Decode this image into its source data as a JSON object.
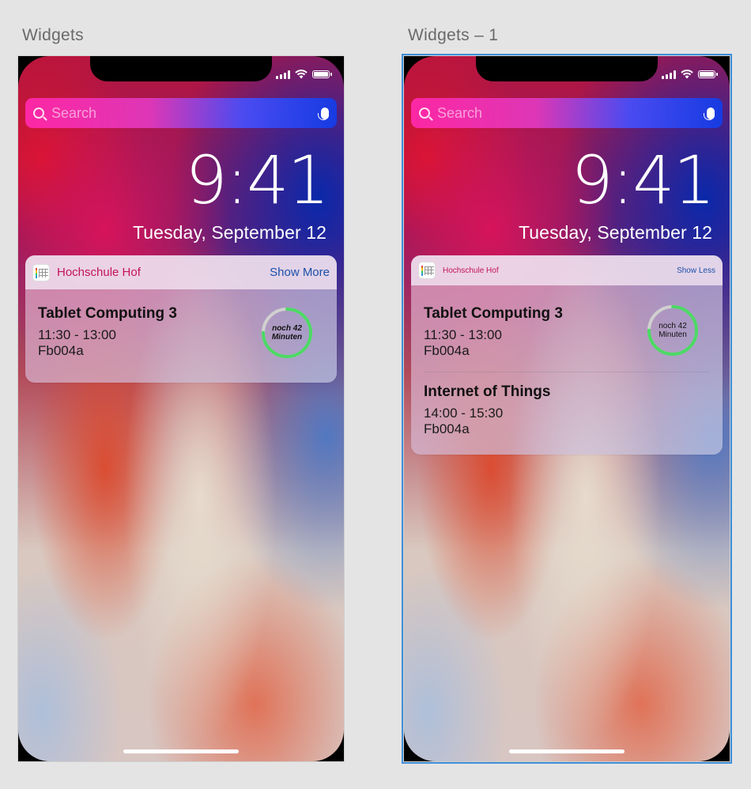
{
  "artboards": [
    {
      "label": "Widgets",
      "status": {
        "signal_icon": "signal-bars-icon",
        "wifi_icon": "wifi-icon",
        "battery_icon": "battery-icon"
      },
      "search_placeholder": "Search",
      "time": "9:41",
      "date": "Tuesday, September 12",
      "widget": {
        "app_name": "Hochschule Hof",
        "toggle_label": "Show More",
        "events": [
          {
            "title": "Tablet Computing 3",
            "time": "11:30 - 13:00",
            "room": "Fb004a",
            "countdown": {
              "line1": "noch 42",
              "line2": "Minuten",
              "progress": 0.75
            }
          }
        ]
      }
    },
    {
      "label": "Widgets – 1",
      "status": {
        "signal_icon": "signal-bars-icon",
        "wifi_icon": "wifi-icon",
        "battery_icon": "battery-icon"
      },
      "search_placeholder": "Search",
      "time": "9:41",
      "date": "Tuesday, September 12",
      "widget": {
        "app_name": "Hochschule Hof",
        "toggle_label": "Show Less",
        "events": [
          {
            "title": "Tablet Computing 3",
            "time": "11:30 - 13:00",
            "room": "Fb004a",
            "countdown": {
              "line1": "noch 42",
              "line2": "Minuten",
              "progress": 0.75
            }
          },
          {
            "title": "Internet of Things",
            "time": "14:00 - 15:30",
            "room": "Fb004a"
          }
        ]
      }
    }
  ],
  "colors": {
    "ring_progress": "#4cd964",
    "ring_track": "#d0d0d0",
    "selection": "#3f8fd8",
    "app_name": "#c2135d",
    "link": "#1b4fa8"
  }
}
